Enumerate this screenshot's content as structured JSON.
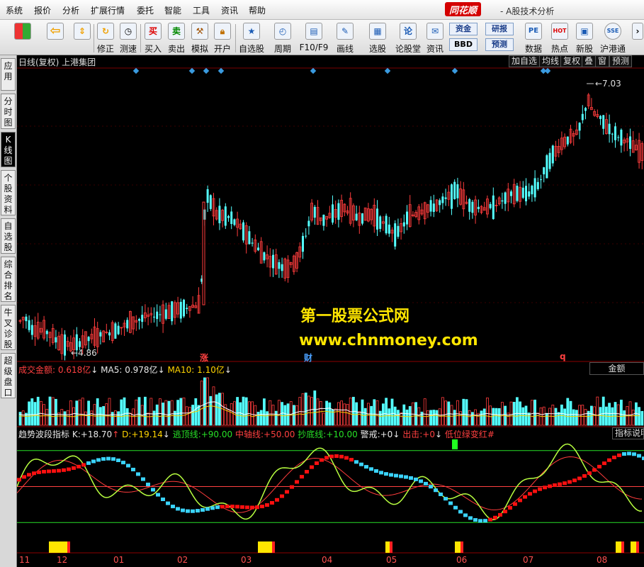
{
  "menu": {
    "items": [
      "系统",
      "报价",
      "分析",
      "扩展行情",
      "委托",
      "智能",
      "工具",
      "资讯",
      "帮助"
    ],
    "brand": "同花顺",
    "app_title": "- A股技术分析"
  },
  "toolbar": {
    "buttons": [
      {
        "label": "",
        "icon": "grid-icon"
      },
      {
        "label": "",
        "icon": "back-arrow-icon"
      },
      {
        "label": "",
        "icon": "up-down-arrows-icon"
      },
      {
        "label": "修正",
        "icon": "fix-icon"
      },
      {
        "label": "测速",
        "icon": "clock-icon"
      },
      {
        "label": "买入",
        "icon": "buy-icon",
        "glyph": "买"
      },
      {
        "label": "卖出",
        "icon": "sell-icon",
        "glyph": "卖"
      },
      {
        "label": "模拟",
        "icon": "hammer-icon"
      },
      {
        "label": "开户",
        "icon": "lock-icon"
      },
      {
        "label": "自选股",
        "icon": "star-icon"
      },
      {
        "label": "周期",
        "icon": "cycle-icon"
      },
      {
        "label": "F10/F9",
        "icon": "f10-icon"
      },
      {
        "label": "画线",
        "icon": "pen-icon"
      },
      {
        "label": "选股",
        "icon": "select-icon"
      },
      {
        "label": "论股堂",
        "icon": "forum-icon",
        "glyph": "论"
      },
      {
        "label": "资讯",
        "icon": "news-icon"
      },
      {
        "label": "数据",
        "icon": "data-icon",
        "glyph": "PE"
      },
      {
        "label": "热点",
        "icon": "hot-icon",
        "glyph": "HOT"
      },
      {
        "label": "新股",
        "icon": "new-stock-icon"
      },
      {
        "label": "沪港通",
        "icon": "sh-hk-icon",
        "glyph": "SSE"
      }
    ],
    "small_buttons": [
      "资金",
      "BBD",
      "研报",
      "预测"
    ]
  },
  "left_tabs": [
    "应用",
    "分时图",
    "K线图",
    "个股资料",
    "自选股",
    "综合排名",
    "牛叉诊股",
    "超级盘口"
  ],
  "active_tab_index": 2,
  "price_panel": {
    "header": "日线(复权)  上港集团",
    "buttons": [
      "加自选",
      "均线",
      "复权",
      "叠",
      "窗",
      "预测"
    ],
    "high_label": "7.03",
    "low_label": "4.86"
  },
  "events": {
    "zhang": "涨",
    "cai": "财",
    "q": "q"
  },
  "volume_panel": {
    "title": "成交金额:",
    "value": "0.618亿",
    "ma5_label": "MA5:",
    "ma5": "0.978亿",
    "ma10_label": "MA10:",
    "ma10": "1.10亿",
    "button": "金额"
  },
  "indicator_panel": {
    "name": "趋势波段指标",
    "k_label": "K:",
    "k": "+18.70",
    "d_label": "D:",
    "d": "+19.14",
    "escape_label": "逃顶线:",
    "escape": "+90.00",
    "middle_label": "中轴线:",
    "middle": "+50.00",
    "bottom_label": "抄底线:",
    "bottom": "+10.00",
    "alert_label": "警戒:",
    "alert": "+0",
    "exit_label": "出击:",
    "exit": "+0",
    "low_buy": "低位绿变红#",
    "button": "指标说明"
  },
  "watermark": {
    "line1": "第一股票公式网",
    "line2": "www.chnmoney.com"
  },
  "x_axis_months": [
    "11",
    "12",
    "01",
    "02",
    "03",
    "04",
    "05",
    "06",
    "07",
    "08"
  ],
  "colors": {
    "up": "#ff3c3c",
    "down": "#54ffff",
    "panel_border": "#8b0000",
    "watermark": "#ffe600"
  },
  "chart_data": {
    "type": "candlestick",
    "series": [
      {
        "name": "日线",
        "high": 7.03,
        "low": 4.86
      }
    ]
  }
}
